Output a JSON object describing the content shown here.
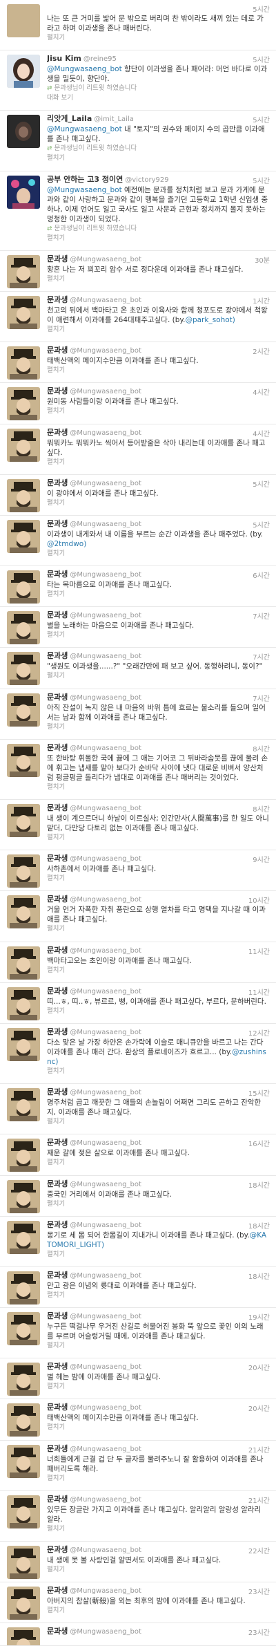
{
  "labels": {
    "expand": "펼치기"
  },
  "tweets": [
    {
      "kind": "top",
      "name": "",
      "handle": "",
      "time": "5시간",
      "text": "나는 또 큰 거미를 밟어 문 밖으로 버리며 찬 밖이라도 새끼 있는 데로 가라고 하며 이과생을 존나 패버린다.",
      "mention": "",
      "suffix": "",
      "footer": "expand",
      "avatar": "plain"
    },
    {
      "kind": "normal",
      "name": "Jisu Kim",
      "handle": "@reine95",
      "time": "5시간",
      "text": "향단이 이과생을 존나 패어라: 머언 바다로 이과생을 밀듯이, 향단아.",
      "mention": "@Mungwasaeng_bot",
      "suffix": "",
      "footer": "rt_actions",
      "rt_note": "문과생님이 리트윗 하였습니다",
      "actions": [
        "대화 보기"
      ],
      "avatar": "girl"
    },
    {
      "kind": "normal",
      "name": "리앗게_Laila",
      "handle": "@imit_Laila",
      "time": "5시간",
      "text": "내 \"토지\"의 권수와 페이지 수의 곱만큼 이과애를 존나 패고싶다.",
      "mention": "@Mungwasaeng_bot",
      "suffix": "",
      "footer": "rt_expand",
      "rt_note": "문과생님이 리트윗 하였습니다",
      "avatar": "dark"
    },
    {
      "kind": "normal",
      "name": "공부 안하는 고3 정이연",
      "handle": "@victory929",
      "time": "5시간",
      "text": "예전에는 문과를 정치처럼 보고 문과 가게에 문과와 같이 사랑하고 문과와 같이 행복을 즐기던 고등학교 1학년 신입생 중 하나, 이제 언어도 일고 국사도 일고 사문과 근현과 정치까지 몰지 못하는 멍청한 이과생이 되었다.",
      "mention": "@Mungwasaeng_bot",
      "suffix": "",
      "footer": "rt_expand",
      "rt_note": "문과생님이 리트윗 하였습니다",
      "avatar": "concert"
    },
    {
      "kind": "normal",
      "name": "문과생",
      "handle": "@Mungwasaeng_bot",
      "time": "30분",
      "text": "황혼 나는 저 꾀꼬리 암수 서로 정다운데 이과애를 존나 패고싶다.",
      "mention": "",
      "suffix": "",
      "footer": "expand",
      "avatar": "scholar"
    },
    {
      "kind": "normal",
      "name": "문과생",
      "handle": "@Mungwasaeng_bot",
      "time": "1시간",
      "text": "천고의 뒤에서 백마타고 온 초인과 이육사와 함께 청포도로 광야에서 척왕이 애련해서 이과애를 264대패주고싶다. (by.",
      "mention": "",
      "suffix": "@park_sohot)",
      "footer": "expand",
      "avatar": "scholar"
    },
    {
      "kind": "normal",
      "name": "문과생",
      "handle": "@Mungwasaeng_bot",
      "time": "2시간",
      "text": "태백산맥의 페이지수만큼 이과애를 존나 패고싶다.",
      "mention": "",
      "suffix": "",
      "footer": "expand",
      "avatar": "scholar"
    },
    {
      "kind": "normal",
      "name": "문과생",
      "handle": "@Mungwasaeng_bot",
      "time": "4시간",
      "text": "원미동 사람들이랑 이과애를 존나 패고싶다.",
      "mention": "",
      "suffix": "",
      "footer": "expand",
      "avatar": "scholar"
    },
    {
      "kind": "normal",
      "name": "문과생",
      "handle": "@Mungwasaeng_bot",
      "time": "4시간",
      "text": "뭐뭐카노 뭐뭐카노 씩어서 등어받줄은 삭아 내리는데 이과애를 존나 패고싶다.",
      "mention": "",
      "suffix": "",
      "footer": "expand",
      "avatar": "scholar"
    },
    {
      "kind": "normal",
      "name": "문과생",
      "handle": "@Mungwasaeng_bot",
      "time": "5시간",
      "text": "이 광야에서 이과애를 존나 패고싶다.",
      "mention": "",
      "suffix": "",
      "footer": "expand",
      "avatar": "scholar"
    },
    {
      "kind": "normal",
      "name": "문과생",
      "handle": "@Mungwasaeng_bot",
      "time": "5시간",
      "text": "이과생이 내게와서 내 이름을 부르는 순간 이과생을 존나 패주었다. (by.",
      "mention": "",
      "suffix": "@2tmdwo)",
      "footer": "expand",
      "avatar": "scholar"
    },
    {
      "kind": "normal",
      "name": "문과생",
      "handle": "@Mungwasaeng_bot",
      "time": "6시간",
      "text": "타는 목마름으로 이과애를 존나 패고싶다.",
      "mention": "",
      "suffix": "",
      "footer": "expand",
      "avatar": "scholar"
    },
    {
      "kind": "normal",
      "name": "문과생",
      "handle": "@Mungwasaeng_bot",
      "time": "7시간",
      "text": "별을 노래하는 마음으로 이과애를 존나 패고싶다.",
      "mention": "",
      "suffix": "",
      "footer": "expand",
      "avatar": "scholar"
    },
    {
      "kind": "normal",
      "name": "문과생",
      "handle": "@Mungwasaeng_bot",
      "time": "7시간",
      "text": "\"생원도 이과생을......?\" \"오래간만에 패 보고 싶어. 동행하려니, 동이?\"",
      "mention": "",
      "suffix": "",
      "footer": "expand",
      "avatar": "scholar"
    },
    {
      "kind": "normal",
      "name": "문과생",
      "handle": "@Mungwasaeng_bot",
      "time": "7시간",
      "text": "아직 잔설이 녹지 않은 내 마음의 바위 틈에 흐르는 물소리를 들으며 일어서는 남과 함께 이과애를 존나 패고싶다.",
      "mention": "",
      "suffix": "",
      "footer": "expand",
      "avatar": "scholar"
    },
    {
      "kind": "normal",
      "name": "문과생",
      "handle": "@Mungwasaeng_bot",
      "time": "8시간",
      "text": "또 한바탕 휘몰한 국에 끓에 그 애는 기어코 그 뒤바라솜뭇를 끊에 물려 손에 휘고는 냅새를 맡아 보다가 순바닥 사이에 냇다 대로운 비벼서 양산처럼 펑글펑글 돌리다가 냅대로 이과애를 존나 패버리는 것이었다.",
      "mention": "",
      "suffix": "",
      "footer": "expand",
      "avatar": "scholar"
    },
    {
      "kind": "normal",
      "name": "문과생",
      "handle": "@Mungwasaeng_bot",
      "time": "8시간",
      "text": "내 생이 계으르더니 하날이 이르실사; 인간만사(人間萬事)를 한 일도 아니 맡더, 다만당 다토리 없는 이과애를 존나 패고싶다.",
      "mention": "",
      "suffix": "",
      "footer": "expand",
      "avatar": "scholar"
    },
    {
      "kind": "normal",
      "name": "문과생",
      "handle": "@Mungwasaeng_bot",
      "time": "9시간",
      "text": "사하촌에서 이과애를 존나 패고싶다.",
      "mention": "",
      "suffix": "",
      "footer": "expand",
      "avatar": "scholar"
    },
    {
      "kind": "normal",
      "name": "문과생",
      "handle": "@Mungwasaeng_bot",
      "time": "10시간",
      "text": "거울 언거 자폭한 자취 풍란으로 상행 열차를 타고 명택을 지나갈 때 이과애를 존나 패고싶다.",
      "mention": "",
      "suffix": "",
      "footer": "expand",
      "avatar": "scholar"
    },
    {
      "kind": "normal",
      "name": "문과생",
      "handle": "@Mungwasaeng_bot",
      "time": "11시간",
      "text": "백마타고오는 초인이랑 이과애를 존나 패고싶다.",
      "mention": "",
      "suffix": "",
      "footer": "expand",
      "avatar": "scholar"
    },
    {
      "kind": "normal",
      "name": "문과생",
      "handle": "@Mungwasaeng_bot",
      "time": "11시간",
      "text": "띠...ㅎ, 띠..ㅎ, 뷰르르, 뻥, 이과애를 존나 패고싶다, 부르다, 문하버린다.",
      "mention": "",
      "suffix": "",
      "footer": "expand",
      "avatar": "scholar"
    },
    {
      "kind": "normal",
      "name": "문과생",
      "handle": "@Mungwasaeng_bot",
      "time": "12시간",
      "text": "다소 맞은 날 가장 하얀은 손가락에 이슬로 매니큐안을 바르고 나는 간다 이과애를 존나 패러 간다. 환상의 플로네이즈가 흐르고... (by.",
      "mention": "",
      "suffix": "@zushinsnc)",
      "footer": "expand",
      "avatar": "scholar"
    },
    {
      "kind": "normal",
      "name": "문과생",
      "handle": "@Mungwasaeng_bot",
      "time": "15시간",
      "text": "명주처럼 곱고 깨끗한 그 애들의 손놀림이 어쩌면 그리도 곤하고 잔악한지, 이과애를 존나 패고싶다.",
      "mention": "",
      "suffix": "",
      "footer": "expand",
      "avatar": "scholar"
    },
    {
      "kind": "normal",
      "name": "문과생",
      "handle": "@Mungwasaeng_bot",
      "time": "16시간",
      "text": "재운 갈에 젖은 살으로 이과애를 존나 패고싶다.",
      "mention": "",
      "suffix": "",
      "footer": "expand",
      "avatar": "scholar"
    },
    {
      "kind": "normal",
      "name": "문과생",
      "handle": "@Mungwasaeng_bot",
      "time": "18시간",
      "text": "중국인 거리에서 이과애를 존나 패고싶다.",
      "mention": "",
      "suffix": "",
      "footer": "expand",
      "avatar": "scholar"
    },
    {
      "kind": "normal",
      "name": "문과생",
      "handle": "@Mungwasaeng_bot",
      "time": "18시간",
      "text": "몽기로 세 몸 되어 한몸길이 지내가니 이과애를 존나 패고싶다. (by.",
      "mention": "",
      "suffix": "@KATOMORI_LIGHT)",
      "footer": "expand",
      "avatar": "scholar"
    },
    {
      "kind": "normal",
      "name": "문과생",
      "handle": "@Mungwasaeng_bot",
      "time": "18시간",
      "text": "만고 광은 이념의 륫대로 이과애를 존나 패고싶다.",
      "mention": "",
      "suffix": "",
      "footer": "expand",
      "avatar": "scholar"
    },
    {
      "kind": "normal",
      "name": "문과생",
      "handle": "@Mungwasaeng_bot",
      "time": "19시간",
      "text": "누구든 떡걸나무 우거진 산길로 허물어진 봉화 뚝 앞으로 꽃인 이의 노래를 부르며 어슬렁거릴 때에, 이과애를 존나 패고싶다.",
      "mention": "",
      "suffix": "",
      "footer": "expand",
      "avatar": "scholar"
    },
    {
      "kind": "normal",
      "name": "문과생",
      "handle": "@Mungwasaeng_bot",
      "time": "20시간",
      "text": "별 헤는 밤에 이과애를 존나 패고싶다.",
      "mention": "",
      "suffix": "",
      "footer": "expand",
      "avatar": "scholar"
    },
    {
      "kind": "normal",
      "name": "문과생",
      "handle": "@Mungwasaeng_bot",
      "time": "20시간",
      "text": "태백산맥의 페이지수만큼 이과애를 존나 패고싶다.",
      "mention": "",
      "suffix": "",
      "footer": "expand",
      "avatar": "scholar"
    },
    {
      "kind": "normal",
      "name": "문과생",
      "handle": "@Mungwasaeng_bot",
      "time": "21시간",
      "text": "너희들에게 근결 겁 단 두 글자를 물려주노니 잘 활용하여 이과애를 존나 패버리도록 해라.",
      "mention": "",
      "suffix": "",
      "footer": "expand",
      "avatar": "scholar"
    },
    {
      "kind": "normal",
      "name": "문과생",
      "handle": "@Mungwasaeng_bot",
      "time": "21시간",
      "text": "있무든 장글란 가지고 이과애를 존나 패고싶다. 알리알리 알랑성 알라리 알라.",
      "mention": "",
      "suffix": "",
      "footer": "expand",
      "avatar": "scholar"
    },
    {
      "kind": "normal",
      "name": "문과생",
      "handle": "@Mungwasaeng_bot",
      "time": "22시간",
      "text": "내 생에 못 볼 사랑인걸 알면서도 이과애를 존나 패고싶다.",
      "mention": "",
      "suffix": "",
      "footer": "expand",
      "avatar": "scholar"
    },
    {
      "kind": "normal",
      "name": "문과생",
      "handle": "@Mungwasaeng_bot",
      "time": "23시간",
      "text": "아버지의 참살(斬殺)을 외는 최후의 밤에 이과애를 존나 패고싶다.",
      "mention": "",
      "suffix": "",
      "footer": "expand",
      "avatar": "scholar"
    },
    {
      "kind": "normal",
      "name": "문과생",
      "handle": "@Mungwasaeng_bot",
      "time": "23시간",
      "text": "",
      "mention": "",
      "suffix": "",
      "footer": "none",
      "avatar": "scholar"
    }
  ]
}
